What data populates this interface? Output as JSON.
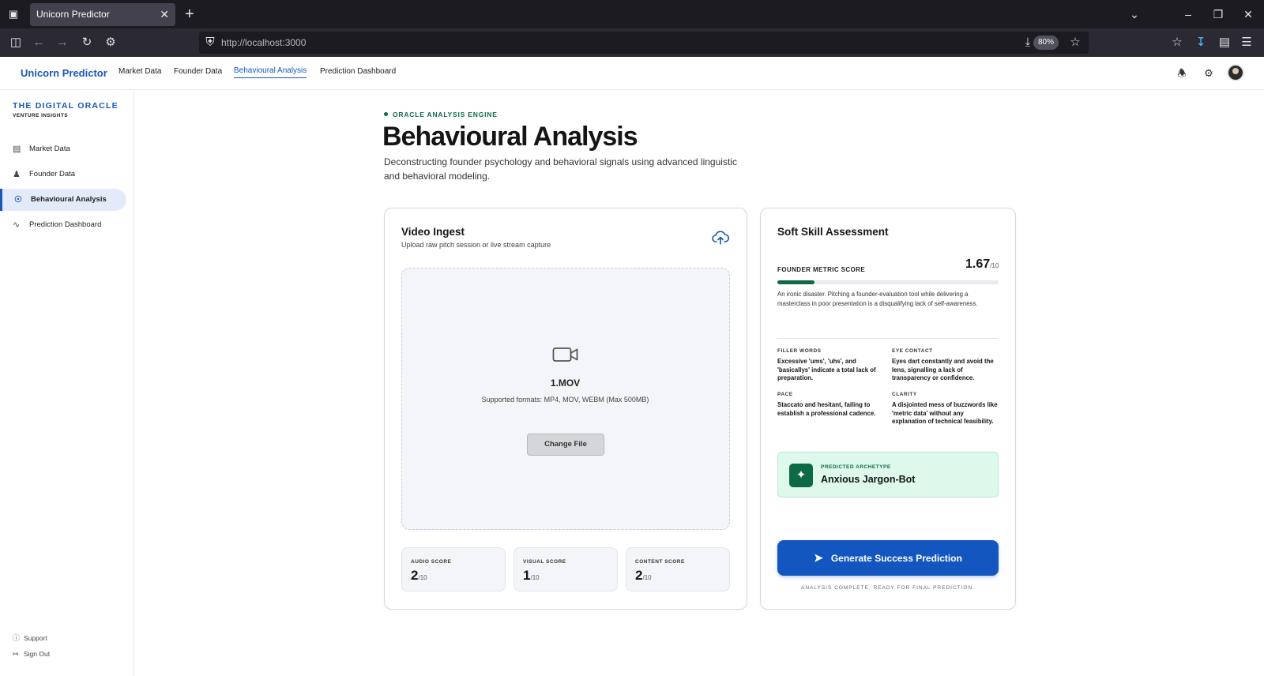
{
  "browser": {
    "tab_title": "Unicorn Predictor",
    "url": "http://localhost:3000",
    "zoom": "80%"
  },
  "header": {
    "brand": "Unicorn Predictor",
    "nav": [
      "Market Data",
      "Founder Data",
      "Behavioural Analysis",
      "Prediction Dashboard"
    ],
    "active_nav": "Behavioural Analysis"
  },
  "sidebar": {
    "title": "THE DIGITAL ORACLE",
    "subtitle": "VENTURE INSIGHTS",
    "items": [
      {
        "label": "Market Data",
        "icon": "bar-chart-icon"
      },
      {
        "label": "Founder Data",
        "icon": "users-icon"
      },
      {
        "label": "Behavioural Analysis",
        "icon": "microphone-icon"
      },
      {
        "label": "Prediction Dashboard",
        "icon": "activity-icon"
      }
    ],
    "footer": [
      {
        "label": "Support",
        "icon": "help-icon"
      },
      {
        "label": "Sign Out",
        "icon": "sign-out-icon"
      }
    ]
  },
  "main": {
    "eyebrow": "ORACLE ANALYSIS ENGINE",
    "title": "Behavioural Analysis",
    "description": "Deconstructing founder psychology and behavioral signals using advanced linguistic and behavioral modeling."
  },
  "video_ingest": {
    "title": "Video Ingest",
    "subtitle": "Upload raw pitch session or live stream capture",
    "file_name": "1.MOV",
    "formats": "Supported formats: MP4, MOV, WEBM (Max 500MB)",
    "change_button": "Change File",
    "scores": [
      {
        "label": "AUDIO SCORE",
        "value": "2",
        "max": "/10"
      },
      {
        "label": "VISUAL SCORE",
        "value": "1",
        "max": "/10"
      },
      {
        "label": "CONTENT SCORE",
        "value": "2",
        "max": "/10"
      }
    ]
  },
  "soft_skill": {
    "title": "Soft Skill Assessment",
    "metric_label": "FOUNDER METRIC SCORE",
    "metric_value": "1.67",
    "metric_max": "/10",
    "metric_fraction": 0.167,
    "verdict": "An ironic disaster. Pitching a founder-evaluation tool while delivering a masterclass in poor presentation is a disqualifying lack of self-awareness.",
    "traits": [
      {
        "label": "FILLER WORDS",
        "text": "Excessive 'ums', 'uhs', and 'basicallys' indicate a total lack of preparation."
      },
      {
        "label": "EYE CONTACT",
        "text": "Eyes dart constantly and avoid the lens, signalling a lack of transparency or confidence."
      },
      {
        "label": "PACE",
        "text": "Staccato and hesitant, failing to establish a professional cadence."
      },
      {
        "label": "CLARITY",
        "text": "A disjointed mess of buzzwords like 'metric data' without any explanation of technical feasibility."
      }
    ],
    "archetype_label": "PREDICTED ARCHETYPE",
    "archetype_name": "Anxious Jargon-Bot",
    "generate_button": "Generate Success Prediction",
    "status": "ANALYSIS COMPLETE. READY FOR FINAL PREDICTION."
  },
  "colors": {
    "brand_blue": "#1757b8",
    "accent_green": "#0e6a45",
    "button_blue": "#1456c0"
  }
}
